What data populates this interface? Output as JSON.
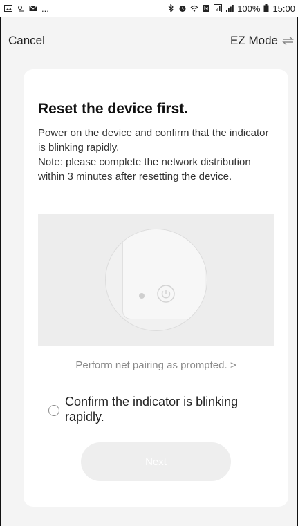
{
  "status_bar": {
    "left_ellipsis": "...",
    "battery": "100%",
    "time": "15:00",
    "icons": [
      "image-icon",
      "weather-icon",
      "mail-icon",
      "bluetooth-icon",
      "alarm-icon",
      "wifi-icon",
      "nfc-icon",
      "signal-icon",
      "signal-icon",
      "battery-icon"
    ]
  },
  "header": {
    "cancel_label": "Cancel",
    "mode_label": "EZ Mode",
    "mode_icon": "swap-icon"
  },
  "card": {
    "title": "Reset the device first.",
    "description": "Power on the device and confirm that the indicator is blinking rapidly.\nNote: please complete the network distribution within 3 minutes after resetting the device.",
    "prompt_link": "Perform net pairing as prompted. >",
    "confirm_label": "Confirm the indicator is blinking rapidly.",
    "next_label": "Next"
  },
  "colors": {
    "background": "#f4f4f4",
    "card": "#ffffff",
    "next_button_bg": "#eeeeee",
    "muted_text": "#8a8a8a"
  }
}
